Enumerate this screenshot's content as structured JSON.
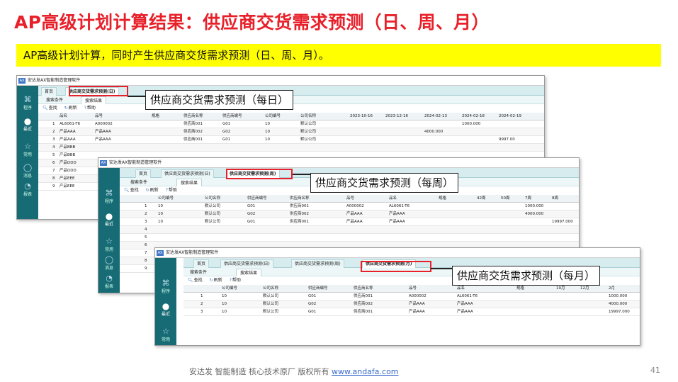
{
  "slide": {
    "title": "AP高级计划计算结果：供应商交货需求预测（日、周、月）",
    "subtitle": "AP高级计划计算，同时产生供应商交货需求预测（日、周、月）。",
    "footer_text": "安达发  智能制造 核心技术原厂  版权所有  ",
    "footer_link": "www.andafa.com",
    "page_number": "41"
  },
  "app": {
    "window_title": "安达发AX智能制造管理软件",
    "logo": "AX",
    "sidebar": [
      {
        "icon": "grid-icon",
        "label": "程序"
      },
      {
        "icon": "clock-icon",
        "label": "最近"
      },
      {
        "icon": "star-icon",
        "label": "常用"
      },
      {
        "icon": "chat-icon",
        "label": "消息"
      },
      {
        "icon": "pie-icon",
        "label": "报表"
      }
    ],
    "home_tab": "首页",
    "sub_tabs": [
      "搜索条件",
      "搜索结果"
    ],
    "toolbar": {
      "search": "查找",
      "refresh": "刷新",
      "help": "帮助"
    }
  },
  "daily": {
    "tab": "供应商交货需求预测(日)",
    "callout": "供应商交货需求预测（每日）",
    "columns": [
      "品名",
      "品号",
      "规格",
      "供应商名称",
      "供应商编号",
      "公司编号",
      "公司名称",
      "2023-10-16",
      "2023-12-16",
      "2024-02-13",
      "2024-02-18",
      "2024-02-19"
    ],
    "rows": [
      {
        "n": "1",
        "c": [
          "AL6061-T6",
          "A000002",
          "",
          "供应商001",
          "G01",
          "10",
          "默认公司",
          "",
          "",
          "",
          "1000.000",
          ""
        ]
      },
      {
        "n": "2",
        "c": [
          "产品AAA",
          "产品AAA",
          "",
          "供应商002",
          "G02",
          "10",
          "默认公司",
          "",
          "",
          "4000.000",
          "",
          ""
        ]
      },
      {
        "n": "3",
        "c": [
          "产品AAA",
          "产品AAA",
          "",
          "供应商001",
          "G01",
          "10",
          "默认公司",
          "",
          "",
          "",
          "",
          "9997.00"
        ]
      },
      {
        "n": "4",
        "c": [
          "产品BBB"
        ]
      },
      {
        "n": "5",
        "c": [
          "产品BBB"
        ]
      },
      {
        "n": "6",
        "c": [
          "产品DDD"
        ]
      },
      {
        "n": "7",
        "c": [
          "产品DDD"
        ]
      },
      {
        "n": "8",
        "c": [
          "产品EEE"
        ]
      },
      {
        "n": "9",
        "c": [
          "产品EEE"
        ]
      }
    ]
  },
  "weekly": {
    "tab": "供应商交货需求预测(周)",
    "callout": "供应商交货需求预测（每周）",
    "columns": [
      "公司编号",
      "公司名称",
      "供应商编号",
      "供应商名称",
      "品号",
      "品名",
      "规格",
      "42周",
      "50周",
      "7周",
      "8周"
    ],
    "rows": [
      {
        "n": "1",
        "c": [
          "10",
          "默认公司",
          "G01",
          "供应商001",
          "A000002",
          "AL6061-T6",
          "",
          "",
          "",
          "1000.000",
          ""
        ]
      },
      {
        "n": "2",
        "c": [
          "10",
          "默认公司",
          "G02",
          "供应商002",
          "产品AAA",
          "产品AAA",
          "",
          "",
          "",
          "4000.000",
          ""
        ]
      },
      {
        "n": "3",
        "c": [
          "10",
          "默认公司",
          "G01",
          "供应商001",
          "产品AAA",
          "产品AAA",
          "",
          "",
          "",
          "",
          "19997.000"
        ]
      },
      {
        "n": "4",
        "c": []
      },
      {
        "n": "5",
        "c": []
      },
      {
        "n": "6",
        "c": []
      },
      {
        "n": "7",
        "c": []
      },
      {
        "n": "8",
        "c": []
      },
      {
        "n": "9",
        "c": []
      }
    ]
  },
  "monthly": {
    "tab": "供应商交货需求预测(月)",
    "callout": "供应商交货需求预测（每月）",
    "columns": [
      "公司编号",
      "公司名称",
      "供应商编号",
      "供应商名称",
      "品号",
      "品名",
      "规格",
      "10月",
      "12月",
      "2月"
    ],
    "rows": [
      {
        "n": "1",
        "c": [
          "10",
          "默认公司",
          "G01",
          "供应商001",
          "A000002",
          "AL6061-T6",
          "",
          "",
          "",
          "1000.000"
        ]
      },
      {
        "n": "2",
        "c": [
          "10",
          "默认公司",
          "G02",
          "供应商002",
          "产品AAA",
          "产品AAA",
          "",
          "",
          "",
          "4000.000"
        ]
      },
      {
        "n": "3",
        "c": [
          "10",
          "默认公司",
          "G01",
          "供应商001",
          "产品AAA",
          "产品AAA",
          "",
          "",
          "",
          "19997.000"
        ]
      }
    ]
  }
}
